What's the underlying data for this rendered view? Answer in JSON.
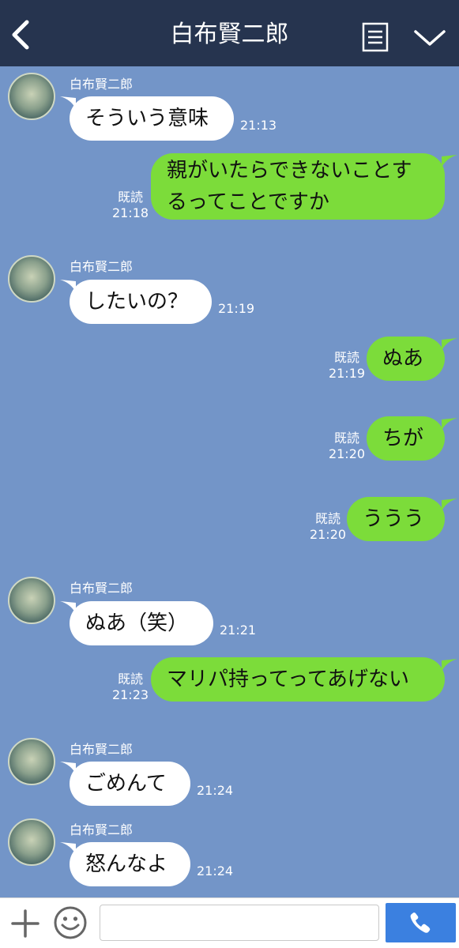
{
  "header": {
    "title": "白布賢二郎",
    "back_icon": "chevron-left-icon",
    "menu_icon": "document-list-icon",
    "collapse_icon": "chevron-down-icon",
    "background": "#26344f"
  },
  "chat": {
    "background": "#7395c8",
    "incoming_bubble_color": "#ffffff",
    "outgoing_bubble_color": "#7cdc3a",
    "messages": [
      {
        "direction": "in",
        "sender": "白布賢二郎",
        "text": "そういう意味",
        "time": "21:13"
      },
      {
        "direction": "out",
        "text": "親がいたらできないことするってことですか",
        "read": "既読",
        "time": "21:18"
      },
      {
        "direction": "in",
        "sender": "白布賢二郎",
        "text": "したいの？",
        "time": "21:19"
      },
      {
        "direction": "out",
        "text": "ぬあ",
        "read": "既読",
        "time": "21:19"
      },
      {
        "direction": "out",
        "text": "ちが",
        "read": "既読",
        "time": "21:20"
      },
      {
        "direction": "out",
        "text": "ううう",
        "read": "既読",
        "time": "21:20"
      },
      {
        "direction": "in",
        "sender": "白布賢二郎",
        "text": "ぬあ（笑）",
        "time": "21:21"
      },
      {
        "direction": "out",
        "text": "マリパ持ってってあげない",
        "read": "既読",
        "time": "21:23"
      },
      {
        "direction": "in",
        "sender": "白布賢二郎",
        "text": "ごめんて",
        "time": "21:24"
      },
      {
        "direction": "in",
        "sender": "白布賢二郎",
        "text": "怒んなよ",
        "time": "21:24"
      }
    ]
  },
  "input_bar": {
    "add_icon": "plus-icon",
    "emoji_icon": "smiley-icon",
    "message_value": "",
    "call_icon": "phone-icon",
    "call_button_color": "#3b80e0"
  }
}
